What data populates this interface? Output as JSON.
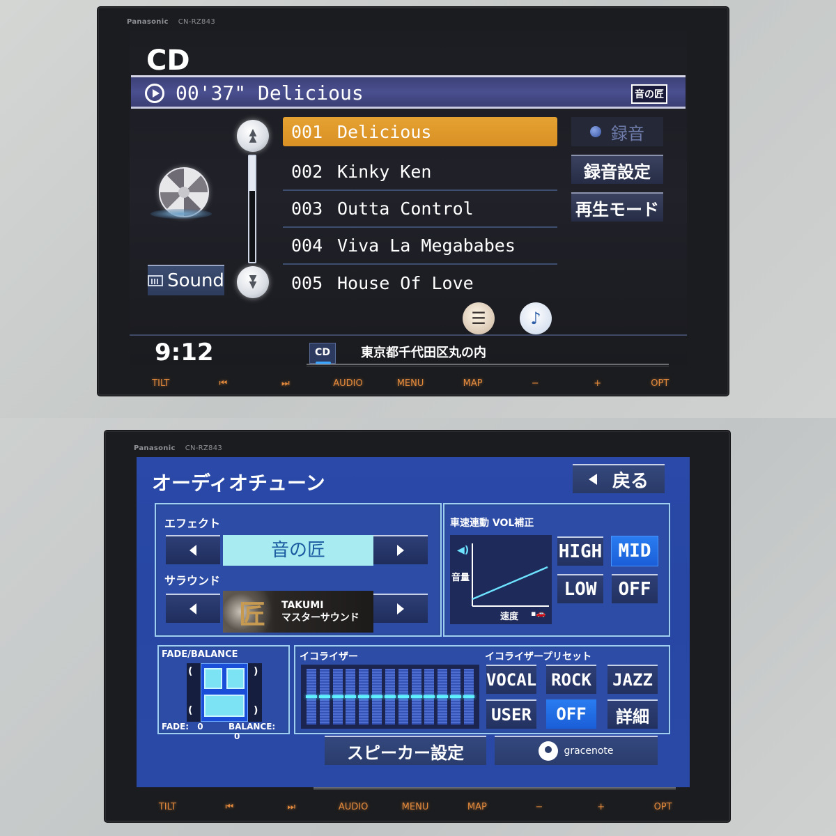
{
  "device": {
    "brand": "Panasonic",
    "model": "CN-RZ843",
    "hardware_buttons": [
      "TILT",
      "⏮",
      "⏭",
      "AUDIO",
      "MENU",
      "MAP",
      "−",
      "+",
      "OPT"
    ]
  },
  "cd_screen": {
    "title": "CD",
    "now_playing": {
      "elapsed": "00'37\"",
      "track_title": "Delicious",
      "display": "00'37\" Delicious",
      "effect_badge": "音の匠"
    },
    "tracks": [
      {
        "num": "001",
        "title": "Delicious",
        "selected": true
      },
      {
        "num": "002",
        "title": "Kinky Ken",
        "selected": false
      },
      {
        "num": "003",
        "title": "Outta Control",
        "selected": false
      },
      {
        "num": "004",
        "title": "Viva La Megababes",
        "selected": false
      },
      {
        "num": "005",
        "title": "House Of Love",
        "selected": false
      }
    ],
    "scroll_position": 0.33,
    "buttons": {
      "record": "録音",
      "record_settings": "録音設定",
      "play_mode": "再生モード",
      "sound": "Sound"
    },
    "icons": [
      "disc-icon",
      "list-icon",
      "music-note-icon"
    ],
    "status": {
      "clock": "9:12",
      "source": "CD",
      "location": "東京都千代田区丸の内"
    }
  },
  "audio_tune_screen": {
    "title": "オーディオチューン",
    "back_label": "戻る",
    "effect": {
      "label": "エフェクト",
      "value": "音の匠"
    },
    "surround": {
      "label": "サラウンド",
      "logo_glyph": "匠",
      "value_line1": "TAKUMI",
      "value_line2": "マスターサウンド"
    },
    "speed_volume": {
      "label": "車速連動 VOL補正",
      "y_axis_label": "音量",
      "x_axis_label": "速度",
      "options": [
        "HIGH",
        "MID",
        "LOW",
        "OFF"
      ],
      "selected": "MID"
    },
    "fade_balance": {
      "label": "FADE/BALANCE",
      "fade_label": "FADE:",
      "fade_value": "0",
      "balance_label": "BALANCE:",
      "balance_value": "0"
    },
    "equalizer": {
      "label": "イコライザー",
      "bands": 13,
      "levels": [
        0,
        0,
        0,
        0,
        0,
        0,
        0,
        0,
        0,
        0,
        0,
        0,
        0
      ],
      "range": [
        -1,
        1
      ]
    },
    "eq_presets": {
      "label": "イコライザープリセット",
      "options": [
        "VOCAL",
        "ROCK",
        "JAZZ",
        "USER",
        "OFF",
        "詳細"
      ],
      "selected": "OFF"
    },
    "speaker_settings": "スピーカー設定",
    "gracenote": "gracenote"
  }
}
